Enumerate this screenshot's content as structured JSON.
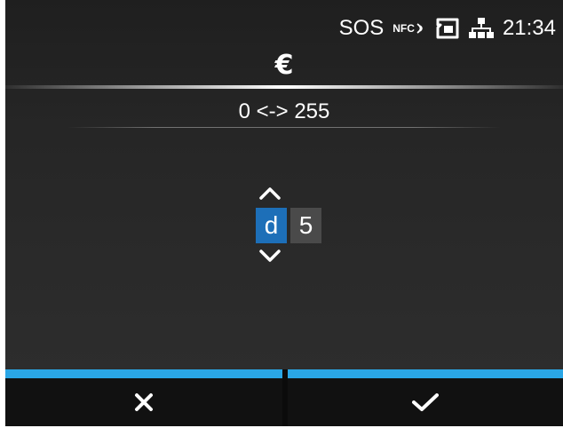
{
  "status_bar": {
    "sos": "SOS",
    "nfc": "NFC",
    "time": "21:34",
    "icons": [
      "nfc-icon",
      "sd-card-icon",
      "network-icon"
    ]
  },
  "screen": {
    "title": "€",
    "range": "0 <-> 255"
  },
  "spinner": {
    "digits": [
      "d",
      "5"
    ],
    "active_index": 0
  },
  "buttons": {
    "cancel_icon": "close-icon",
    "confirm_icon": "checkmark-icon"
  },
  "colors": {
    "accent": "#2aa6e6",
    "selected_digit": "#1d6fb8",
    "background": "#2a2a2a"
  }
}
